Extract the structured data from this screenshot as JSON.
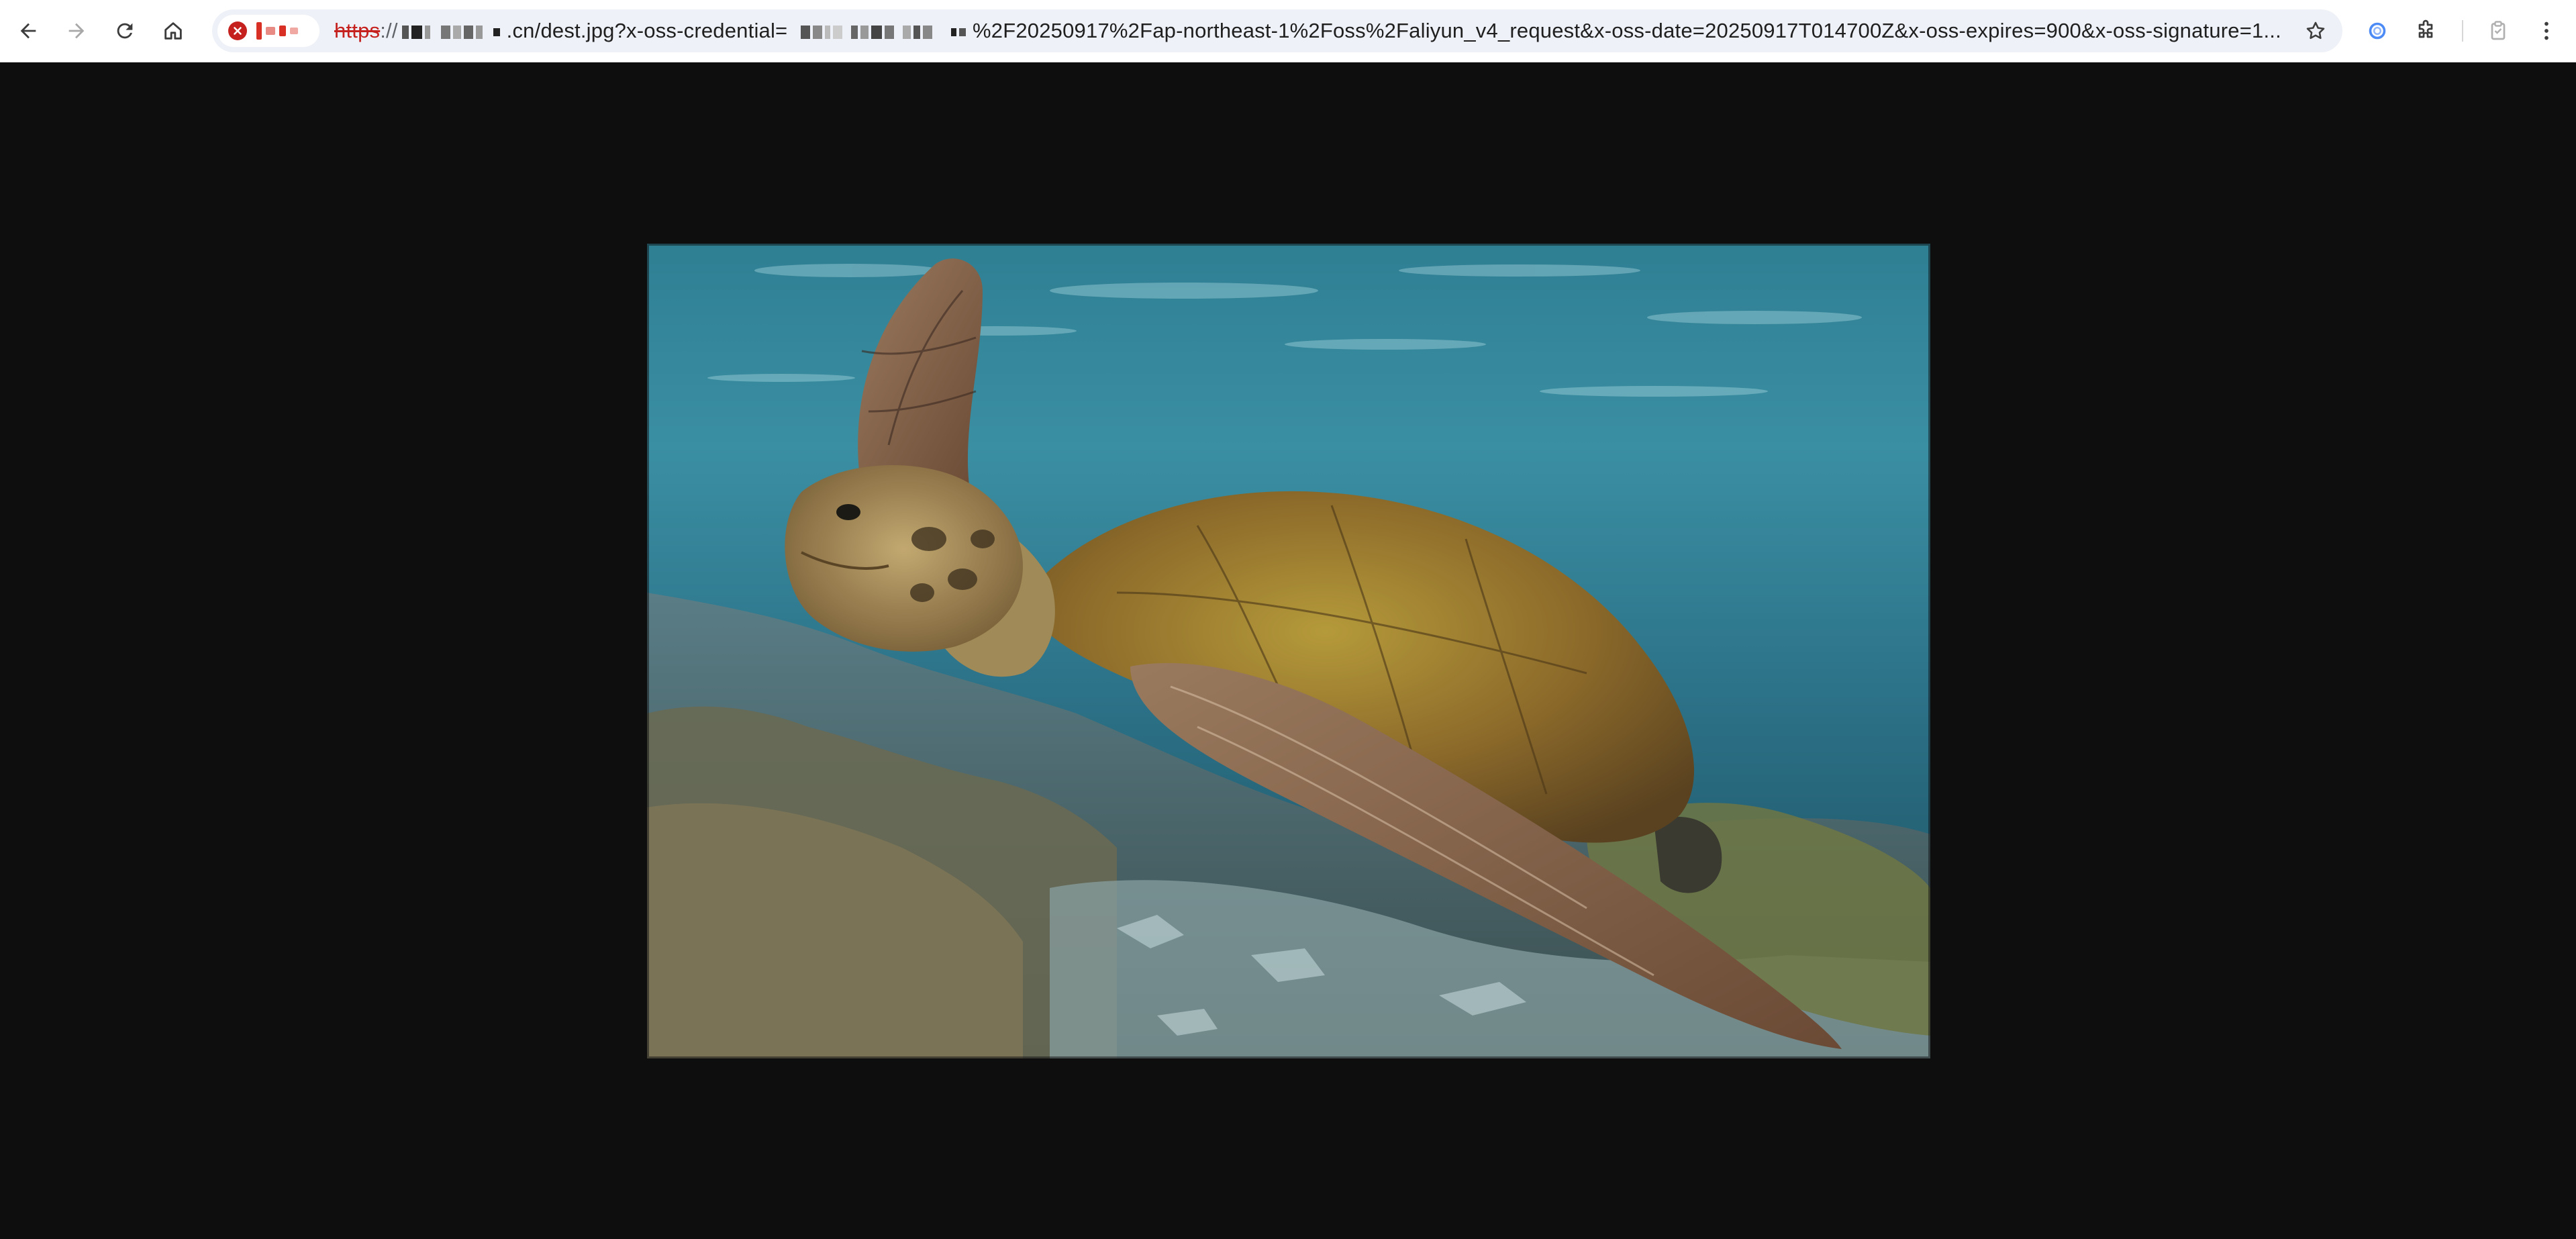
{
  "browser": {
    "nav": {
      "back": "arrow-left-icon",
      "forward": "arrow-right-icon",
      "reload": "reload-icon",
      "home": "home-icon"
    },
    "address_bar": {
      "security_state": "not-secure",
      "url_scheme": "https",
      "url_separator": "://",
      "url_domain_suffix": ".cn/dest.jpg?x-oss-credential=",
      "url_rest": "%2F20250917%2Fap-northeast-1%2Foss%2Faliyun_v4_request&x-oss-date=20250917T014700Z&x-oss-expires=900&x-oss-signature=1..."
    },
    "colors": {
      "accent_blue": "#4c8bf5",
      "error_red": "#c5221f"
    }
  },
  "viewer": {
    "background": "#0e0e0f",
    "image_subject": "sea turtle swimming underwater over a coral reef"
  }
}
